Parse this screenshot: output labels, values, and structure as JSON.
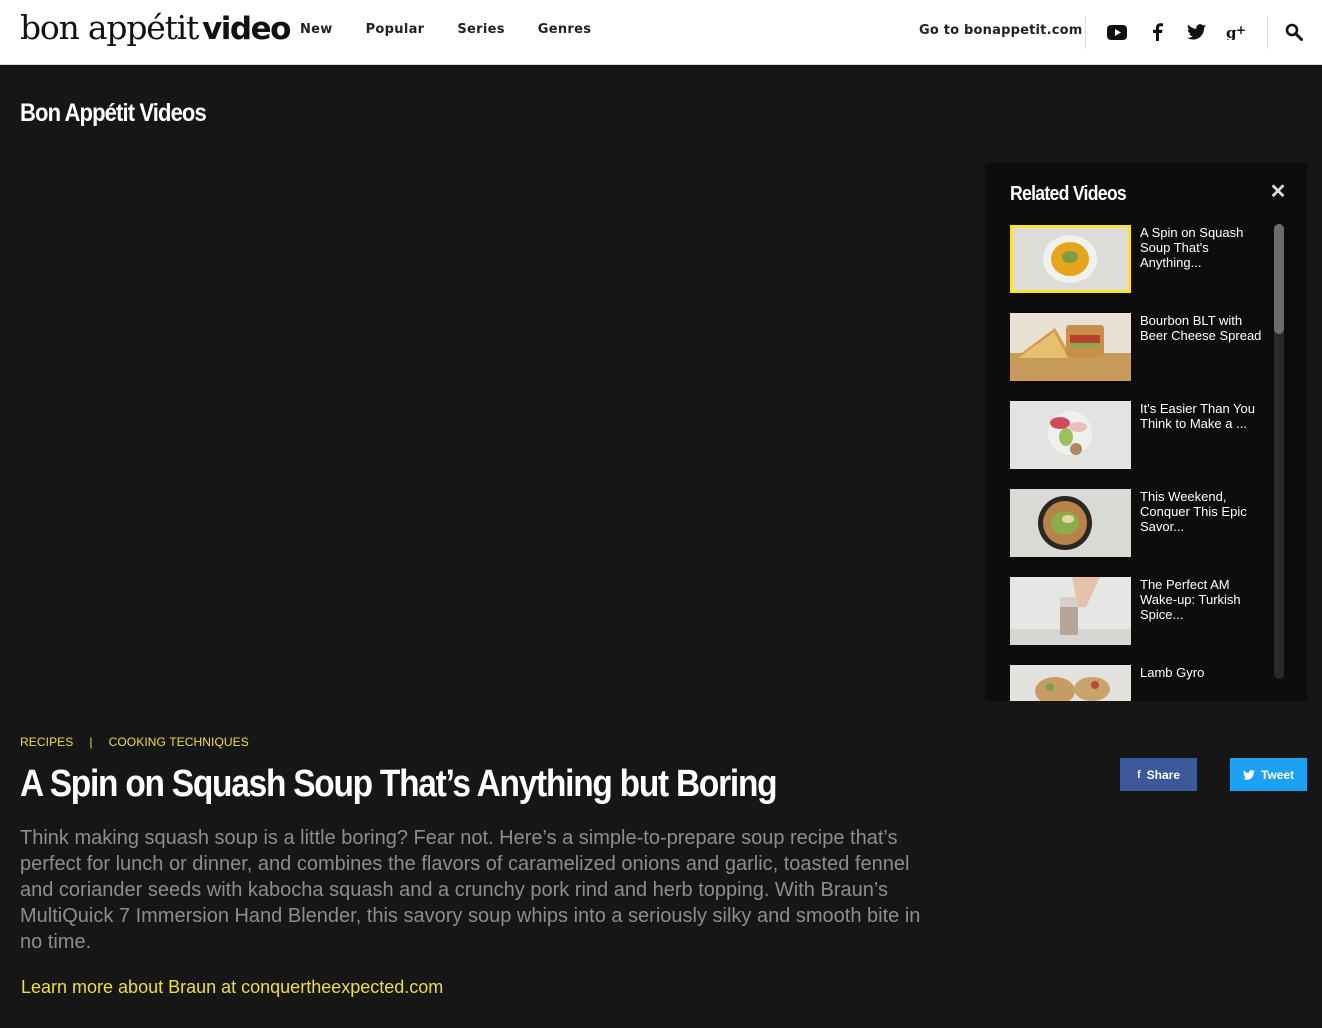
{
  "header": {
    "logo_text_1": "bon appétit",
    "logo_text_2": "video",
    "nav": [
      "New",
      "Popular",
      "Series",
      "Genres"
    ],
    "goto_label": "Go to bonappetit.com",
    "social_icons": [
      "youtube-icon",
      "facebook-icon",
      "twitter-icon",
      "google-plus-icon"
    ],
    "search_icon": "search-icon"
  },
  "page": {
    "heading": "Bon Appétit Videos"
  },
  "related": {
    "title": "Related Videos",
    "close_icon": "close-icon",
    "items": [
      {
        "title": "A Spin on Squash Soup That's Anything...",
        "active": true
      },
      {
        "title": "Bourbon BLT with Beer Cheese Spread",
        "active": false
      },
      {
        "title": "It's Easier Than You Think to Make a ...",
        "active": false
      },
      {
        "title": "This Weekend, Conquer This Epic Savor...",
        "active": false
      },
      {
        "title": "The Perfect AM Wake-up: Turkish Spice...",
        "active": false
      },
      {
        "title": "Lamb Gyro",
        "active": false
      }
    ]
  },
  "article": {
    "crumbs": [
      "RECIPES",
      "COOKING TECHNIQUES"
    ],
    "crumb_separator": "|",
    "headline": "A Spin on Squash Soup That’s Anything but Boring",
    "description": "Think making squash soup is a little boring? Fear not. Here’s a simple-to-prepare soup recipe that’s perfect for lunch or dinner, and combines the flavors of caramelized onions and garlic, toasted fennel and coriander seeds with kabocha squash and a crunchy pork rind and herb topping. With Braun’s MultiQuick 7 Immersion Hand Blender, this savory soup whips into a seriously silky and smooth bite in no time.",
    "learn_more": "Learn more about Braun at conquertheexpected.com",
    "share_label": "Share",
    "tweet_label": "Tweet"
  },
  "colors": {
    "accent_yellow": "#f0de3a",
    "background": "#161616",
    "facebook_blue": "#3b5998",
    "twitter_blue": "#1da1f2"
  }
}
